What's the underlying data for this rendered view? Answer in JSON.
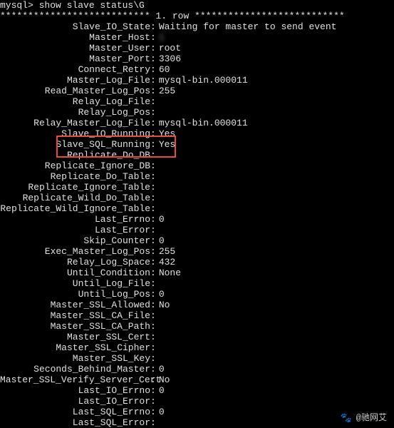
{
  "prompt": "mysql> show slave status\\G",
  "row_header": "*************************** 1. row ***************************",
  "fields": [
    {
      "label": "Slave_IO_State",
      "value": "Waiting for master to send event"
    },
    {
      "label": "Master_Host",
      "value": "1            "
    },
    {
      "label": "Master_User",
      "value": "root"
    },
    {
      "label": "Master_Port",
      "value": "3306"
    },
    {
      "label": "Connect_Retry",
      "value": "60"
    },
    {
      "label": "Master_Log_File",
      "value": "mysql-bin.000011"
    },
    {
      "label": "Read_Master_Log_Pos",
      "value": "255"
    },
    {
      "label": "Relay_Log_File",
      "value": "                    "
    },
    {
      "label": "Relay_Log_Pos",
      "value": "     "
    },
    {
      "label": "Relay_Master_Log_File",
      "value": "mysql-bin.000011"
    },
    {
      "label": "Slave_IO_Running",
      "value": "Yes"
    },
    {
      "label": "Slave_SQL_Running",
      "value": "Yes"
    },
    {
      "label": "Replicate_Do_DB",
      "value": ""
    },
    {
      "label": "Replicate_Ignore_DB",
      "value": ""
    },
    {
      "label": "Replicate_Do_Table",
      "value": ""
    },
    {
      "label": "Replicate_Ignore_Table",
      "value": ""
    },
    {
      "label": "Replicate_Wild_Do_Table",
      "value": ""
    },
    {
      "label": "Replicate_Wild_Ignore_Table",
      "value": ""
    },
    {
      "label": "Last_Errno",
      "value": "0"
    },
    {
      "label": "Last_Error",
      "value": ""
    },
    {
      "label": "Skip_Counter",
      "value": "0"
    },
    {
      "label": "Exec_Master_Log_Pos",
      "value": "255"
    },
    {
      "label": "Relay_Log_Space",
      "value": "432"
    },
    {
      "label": "Until_Condition",
      "value": "None"
    },
    {
      "label": "Until_Log_File",
      "value": ""
    },
    {
      "label": "Until_Log_Pos",
      "value": "0"
    },
    {
      "label": "Master_SSL_Allowed",
      "value": "No"
    },
    {
      "label": "Master_SSL_CA_File",
      "value": ""
    },
    {
      "label": "Master_SSL_CA_Path",
      "value": ""
    },
    {
      "label": "Master_SSL_Cert",
      "value": ""
    },
    {
      "label": "Master_SSL_Cipher",
      "value": ""
    },
    {
      "label": "Master_SSL_Key",
      "value": ""
    },
    {
      "label": "Seconds_Behind_Master",
      "value": "0"
    },
    {
      "label": "Master_SSL_Verify_Server_Cert",
      "value": "No"
    },
    {
      "label": "Last_IO_Errno",
      "value": "0"
    },
    {
      "label": "Last_IO_Error",
      "value": ""
    },
    {
      "label": "Last_SQL_Errno",
      "value": "0"
    },
    {
      "label": "Last_SQL_Error",
      "value": ""
    }
  ],
  "blurred_indices": [
    1,
    7,
    8
  ],
  "watermark": "@驰网艾"
}
